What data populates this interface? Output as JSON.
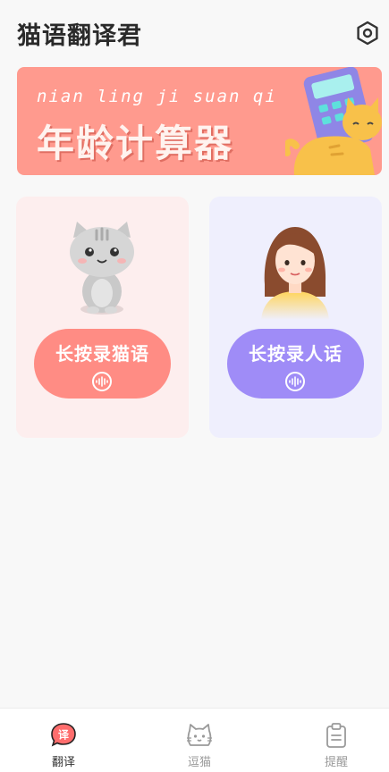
{
  "header": {
    "title": "猫语翻译君",
    "settings_icon": "hexagon-settings-icon"
  },
  "banner": {
    "pinyin": "nian ling ji suan qi",
    "title": "年龄计算器",
    "background": "#ff9a8e"
  },
  "cards": [
    {
      "id": "cat",
      "illustration": "gray-cat-icon",
      "button_label": "长按录猫语",
      "button_color": "#ff8c84",
      "icon": "voice-wave-icon"
    },
    {
      "id": "human",
      "illustration": "girl-avatar-icon",
      "button_label": "长按录人话",
      "button_color": "#9f8cf7",
      "icon": "voice-wave-icon"
    }
  ],
  "bottom_nav": {
    "items": [
      {
        "label": "翻译",
        "icon": "translate-bubble-icon",
        "active": true
      },
      {
        "label": "逗猫",
        "icon": "cat-face-icon",
        "active": false
      },
      {
        "label": "提醒",
        "icon": "clipboard-icon",
        "active": false
      }
    ]
  }
}
